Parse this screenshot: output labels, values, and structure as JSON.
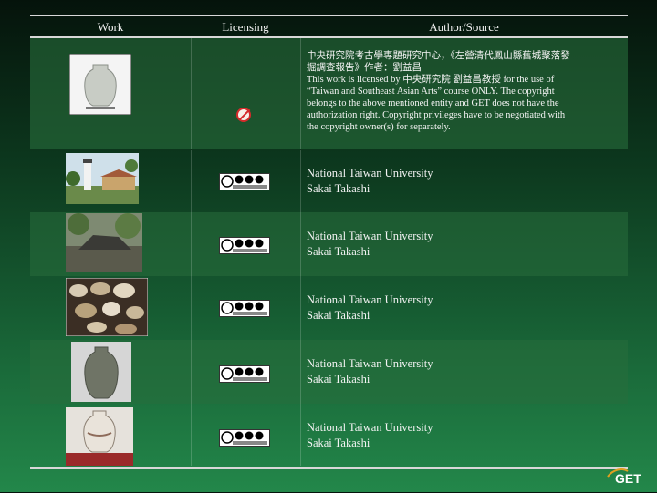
{
  "headers": {
    "work": "Work",
    "licensing": "Licensing",
    "author": "Author/Source"
  },
  "rows": [
    {
      "work_icon": "jar-photo-icon",
      "license_icon": "no-commercial-icon",
      "author_lines": [
        "中央研究院考古學專題研究中心，《左營清代鳳山縣舊城聚落發",
        "掘調查報告》作者：劉益昌",
        "This work is licensed by 中央研究院 劉益昌教授 for the use of",
        "“Taiwan and Southeast Asian Arts” course ONLY. The copyright",
        "belongs to the above mentioned entity and GET does not have the",
        "authorization right. Copyright privileges have to be negotiated with",
        "the copyright owner(s) for separately."
      ]
    },
    {
      "work_icon": "lighthouse-photo-icon",
      "license_icon": "cc-by-nd-sa-icon",
      "author_lines": [
        "National Taiwan University",
        "Sakai Takashi"
      ]
    },
    {
      "work_icon": "ruins-photo-icon",
      "license_icon": "cc-by-nd-sa-icon",
      "author_lines": [
        "National Taiwan University",
        "Sakai Takashi"
      ]
    },
    {
      "work_icon": "shards-photo-icon",
      "license_icon": "cc-by-nd-sa-icon",
      "author_lines": [
        "National Taiwan University",
        "Sakai Takashi"
      ]
    },
    {
      "work_icon": "vase-photo-icon",
      "license_icon": "cc-by-nd-sa-icon",
      "author_lines": [
        "National Taiwan University",
        "Sakai Takashi"
      ]
    },
    {
      "work_icon": "vase-white-photo-icon",
      "license_icon": "cc-by-nd-sa-icon",
      "author_lines": [
        "National Taiwan University",
        "Sakai Takashi"
      ]
    }
  ],
  "cc_badge": {
    "cc": "cc",
    "by": "BY",
    "nd": "ND",
    "sa": "SA"
  },
  "logo": {
    "text": "GET"
  }
}
